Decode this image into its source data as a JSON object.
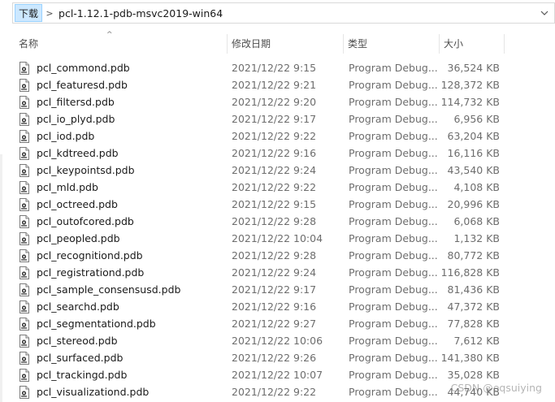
{
  "address": {
    "root_label": "下载",
    "separator": ">",
    "current": "pcl-1.12.1-pdb-msvc2019-win64",
    "dropdown_glyph": "⌄"
  },
  "columns": {
    "name": "名称",
    "date": "修改日期",
    "type": "类型",
    "size": "大小",
    "sort_glyph": "^"
  },
  "icon_name": "pdb-file-icon",
  "files": [
    {
      "name": "pcl_commond.pdb",
      "date": "2021/12/22 9:15",
      "type": "Program Debug...",
      "size": "36,524 KB"
    },
    {
      "name": "pcl_featuresd.pdb",
      "date": "2021/12/22 9:21",
      "type": "Program Debug...",
      "size": "128,372 KB"
    },
    {
      "name": "pcl_filtersd.pdb",
      "date": "2021/12/22 9:20",
      "type": "Program Debug...",
      "size": "114,732 KB"
    },
    {
      "name": "pcl_io_plyd.pdb",
      "date": "2021/12/22 9:17",
      "type": "Program Debug...",
      "size": "6,956 KB"
    },
    {
      "name": "pcl_iod.pdb",
      "date": "2021/12/22 9:22",
      "type": "Program Debug...",
      "size": "63,204 KB"
    },
    {
      "name": "pcl_kdtreed.pdb",
      "date": "2021/12/22 9:16",
      "type": "Program Debug...",
      "size": "16,116 KB"
    },
    {
      "name": "pcl_keypointsd.pdb",
      "date": "2021/12/22 9:24",
      "type": "Program Debug...",
      "size": "43,540 KB"
    },
    {
      "name": "pcl_mld.pdb",
      "date": "2021/12/22 9:22",
      "type": "Program Debug...",
      "size": "4,108 KB"
    },
    {
      "name": "pcl_octreed.pdb",
      "date": "2021/12/22 9:15",
      "type": "Program Debug...",
      "size": "20,996 KB"
    },
    {
      "name": "pcl_outofcored.pdb",
      "date": "2021/12/22 9:28",
      "type": "Program Debug...",
      "size": "6,068 KB"
    },
    {
      "name": "pcl_peopled.pdb",
      "date": "2021/12/22 10:04",
      "type": "Program Debug...",
      "size": "1,132 KB"
    },
    {
      "name": "pcl_recognitiond.pdb",
      "date": "2021/12/22 9:28",
      "type": "Program Debug...",
      "size": "80,772 KB"
    },
    {
      "name": "pcl_registrationd.pdb",
      "date": "2021/12/22 9:24",
      "type": "Program Debug...",
      "size": "116,828 KB"
    },
    {
      "name": "pcl_sample_consensusd.pdb",
      "date": "2021/12/22 9:17",
      "type": "Program Debug...",
      "size": "81,436 KB"
    },
    {
      "name": "pcl_searchd.pdb",
      "date": "2021/12/22 9:16",
      "type": "Program Debug...",
      "size": "47,372 KB"
    },
    {
      "name": "pcl_segmentationd.pdb",
      "date": "2021/12/22 9:27",
      "type": "Program Debug...",
      "size": "77,828 KB"
    },
    {
      "name": "pcl_stereod.pdb",
      "date": "2021/12/22 10:06",
      "type": "Program Debug...",
      "size": "7,612 KB"
    },
    {
      "name": "pcl_surfaced.pdb",
      "date": "2021/12/22 9:26",
      "type": "Program Debug...",
      "size": "141,380 KB"
    },
    {
      "name": "pcl_trackingd.pdb",
      "date": "2021/12/22 10:07",
      "type": "Program Debug...",
      "size": "35,028 KB"
    },
    {
      "name": "pcl_visualizationd.pdb",
      "date": "2021/12/22 9:22",
      "type": "Program Debug...",
      "size": "44,740 KB"
    }
  ],
  "watermark": "CSDN @eqsuiying"
}
